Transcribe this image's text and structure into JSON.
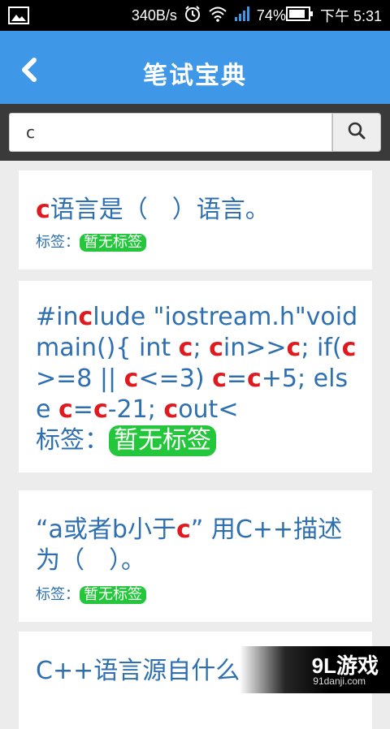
{
  "status_bar": {
    "speed": "340B/s",
    "battery_percent": "74%",
    "time": "下午 5:31",
    "icons": [
      "image-icon",
      "alarm-icon",
      "wifi-icon",
      "signal-icon",
      "battery-icon"
    ]
  },
  "app_bar": {
    "title": "笔试宝典",
    "back_icon": "chevron-left-icon"
  },
  "search": {
    "value": "c",
    "button_icon": "search-icon"
  },
  "tag_prefix": "标签：",
  "items": [
    {
      "segments": [
        {
          "t": "c",
          "hl": true
        },
        {
          "t": "语言是（　）语言。",
          "hl": false
        }
      ],
      "tag": "暂无标签"
    },
    {
      "segments": [
        {
          "t": "#in",
          "hl": false
        },
        {
          "t": "c",
          "hl": true
        },
        {
          "t": "lude \"iostream.h\"void main(){ int ",
          "hl": false
        },
        {
          "t": "c",
          "hl": true
        },
        {
          "t": "; ",
          "hl": false
        },
        {
          "t": "c",
          "hl": true
        },
        {
          "t": "in>>",
          "hl": false
        },
        {
          "t": "c",
          "hl": true
        },
        {
          "t": "; if(",
          "hl": false
        },
        {
          "t": "c",
          "hl": true
        },
        {
          "t": ">=8 || ",
          "hl": false
        },
        {
          "t": "c",
          "hl": true
        },
        {
          "t": "<=3) ",
          "hl": false
        },
        {
          "t": "c",
          "hl": true
        },
        {
          "t": "=",
          "hl": false
        },
        {
          "t": "c",
          "hl": true
        },
        {
          "t": "+5; else ",
          "hl": false
        },
        {
          "t": "c",
          "hl": true
        },
        {
          "t": "=",
          "hl": false
        },
        {
          "t": "c",
          "hl": true
        },
        {
          "t": "-21; ",
          "hl": false
        },
        {
          "t": "c",
          "hl": true
        },
        {
          "t": "out<",
          "hl": false
        }
      ],
      "tag": "暂无标签"
    },
    {
      "segments": [
        {
          "t": "“a或者b小于",
          "hl": false
        },
        {
          "t": "c",
          "hl": true
        },
        {
          "t": "” 用C++描述为（　）。",
          "hl": false
        }
      ],
      "tag": "暂无标签"
    },
    {
      "segments": [
        {
          "t": "C++语言源自什么",
          "hl": false
        }
      ],
      "tag": ""
    }
  ],
  "watermark": {
    "main": "9L游戏",
    "sub": "91danji.com"
  }
}
